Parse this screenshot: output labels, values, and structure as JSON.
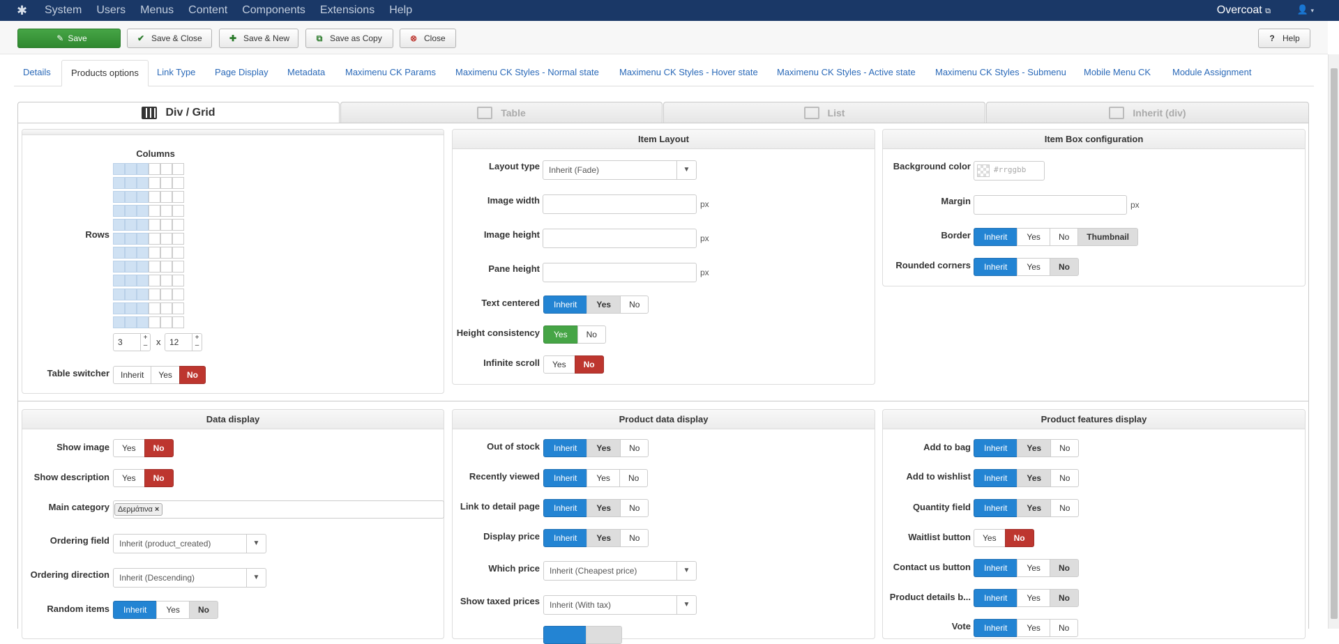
{
  "topbar": {
    "menu": [
      "System",
      "Users",
      "Menus",
      "Content",
      "Components",
      "Extensions",
      "Help"
    ],
    "site_name": "Overcoat",
    "site_link_icon": "external-link-icon",
    "user_icon": "user-icon"
  },
  "toolbar": {
    "save": "Save",
    "save_close": "Save & Close",
    "save_new": "Save & New",
    "save_copy": "Save as Copy",
    "close": "Close",
    "help": "Help"
  },
  "tabs": [
    "Details",
    "Products options",
    "Link Type",
    "Page Display",
    "Metadata",
    "Maximenu CK Params",
    "Maximenu CK Styles - Normal state",
    "Maximenu CK Styles - Hover state",
    "Maximenu CK Styles - Active state",
    "Maximenu CK Styles - Submenu",
    "Mobile Menu CK",
    "Module Assignment"
  ],
  "active_tab": "Products options",
  "view_tabs": [
    "Div / Grid",
    "Table",
    "List",
    "Inherit (div)"
  ],
  "grid_panel": {
    "columns_label": "Columns",
    "rows_label": "Rows",
    "columns_value": "3",
    "x": "x",
    "rows_value": "12",
    "plus": "+",
    "minus": "–",
    "table_switcher_label": "Table switcher",
    "table_switcher": [
      "Inherit",
      "Yes",
      "No"
    ]
  },
  "item_layout": {
    "title": "Item Layout",
    "layout_type_label": "Layout type",
    "layout_type_value": "Inherit (Fade)",
    "image_width_label": "Image width",
    "image_height_label": "Image height",
    "pane_height_label": "Pane height",
    "px": "px",
    "text_centered_label": "Text centered",
    "text_centered": [
      "Inherit",
      "Yes",
      "No"
    ],
    "height_consistency_label": "Height consistency",
    "height_consistency": [
      "Yes",
      "No"
    ],
    "infinite_scroll_label": "Infinite scroll",
    "infinite_scroll": [
      "Yes",
      "No"
    ]
  },
  "item_box": {
    "title": "Item Box configuration",
    "bg_color_label": "Background color",
    "bg_color_placeholder": "#rrggbb",
    "margin_label": "Margin",
    "px": "px",
    "border_label": "Border",
    "border": [
      "Inherit",
      "Yes",
      "No",
      "Thumbnail"
    ],
    "rounded_label": "Rounded corners",
    "rounded": [
      "Inherit",
      "Yes",
      "No"
    ]
  },
  "data_display": {
    "title": "Data display",
    "show_image_label": "Show image",
    "show_image": [
      "Yes",
      "No"
    ],
    "show_desc_label": "Show description",
    "show_desc": [
      "Yes",
      "No"
    ],
    "main_category_label": "Main category",
    "main_category_tag": "Δερμάτινα",
    "ordering_field_label": "Ordering field",
    "ordering_field_value": "Inherit (product_created)",
    "ordering_dir_label": "Ordering direction",
    "ordering_dir_value": "Inherit (Descending)",
    "random_label": "Random items",
    "random": [
      "Inherit",
      "Yes",
      "No"
    ]
  },
  "product_data": {
    "title": "Product data display",
    "out_of_stock_label": "Out of stock",
    "out_of_stock": [
      "Inherit",
      "Yes",
      "No"
    ],
    "recently_viewed_label": "Recently viewed",
    "recently_viewed": [
      "Inherit",
      "Yes",
      "No"
    ],
    "link_detail_label": "Link to detail page",
    "link_detail": [
      "Inherit",
      "Yes",
      "No"
    ],
    "display_price_label": "Display price",
    "display_price": [
      "Inherit",
      "Yes",
      "No"
    ],
    "which_price_label": "Which price",
    "which_price_value": "Inherit (Cheapest price)",
    "taxed_label": "Show taxed prices",
    "taxed_value": "Inherit (With tax)"
  },
  "product_features": {
    "title": "Product features display",
    "add_bag_label": "Add to bag",
    "add_bag": [
      "Inherit",
      "Yes",
      "No"
    ],
    "add_wishlist_label": "Add to wishlist",
    "add_wishlist": [
      "Inherit",
      "Yes",
      "No"
    ],
    "qty_label": "Quantity field",
    "qty": [
      "Inherit",
      "Yes",
      "No"
    ],
    "waitlist_label": "Waitlist button",
    "waitlist": [
      "Yes",
      "No"
    ],
    "contact_label": "Contact us button",
    "contact": [
      "Inherit",
      "Yes",
      "No"
    ],
    "details_btn_label": "Product details b...",
    "details_btn": [
      "Inherit",
      "Yes",
      "No"
    ],
    "vote_label": "Vote",
    "vote": [
      "Inherit",
      "Yes",
      "No"
    ]
  }
}
